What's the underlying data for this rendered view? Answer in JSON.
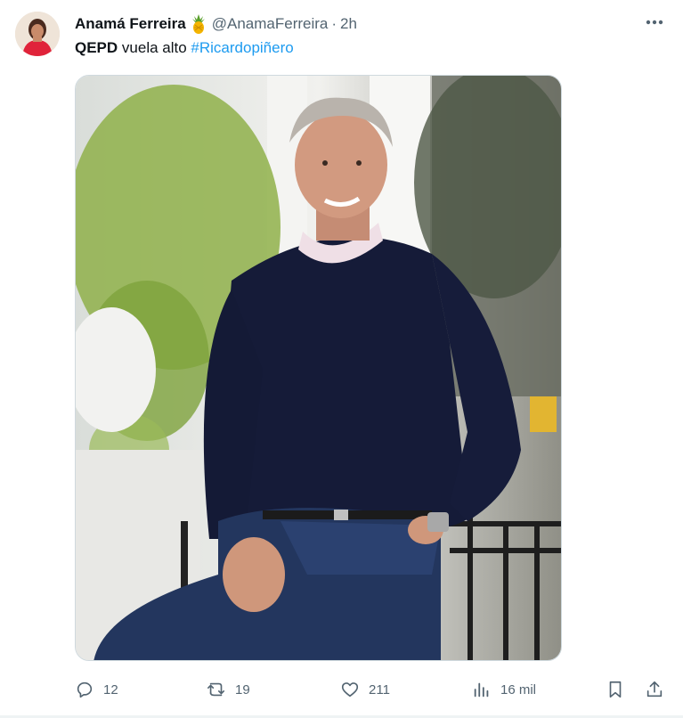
{
  "tweet": {
    "author_name": "Anamá Ferreira",
    "author_emoji": "🍍",
    "handle": "@AnamaFerreira",
    "separator": "·",
    "time": "2h",
    "text_bold": "QEPD",
    "text_plain": " vuela alto ",
    "hashtag": "#Ricardopiñero"
  },
  "actions": {
    "replies": "12",
    "retweets": "19",
    "likes": "211",
    "views": "16 mil"
  },
  "icons": {
    "more": "more-dots-icon",
    "reply": "reply-icon",
    "retweet": "retweet-icon",
    "like": "heart-icon",
    "views": "views-chart-icon",
    "bookmark": "bookmark-icon",
    "share": "share-icon"
  },
  "colors": {
    "link": "#1d9bf0",
    "secondary_text": "#536471",
    "primary_text": "#0f1419"
  }
}
